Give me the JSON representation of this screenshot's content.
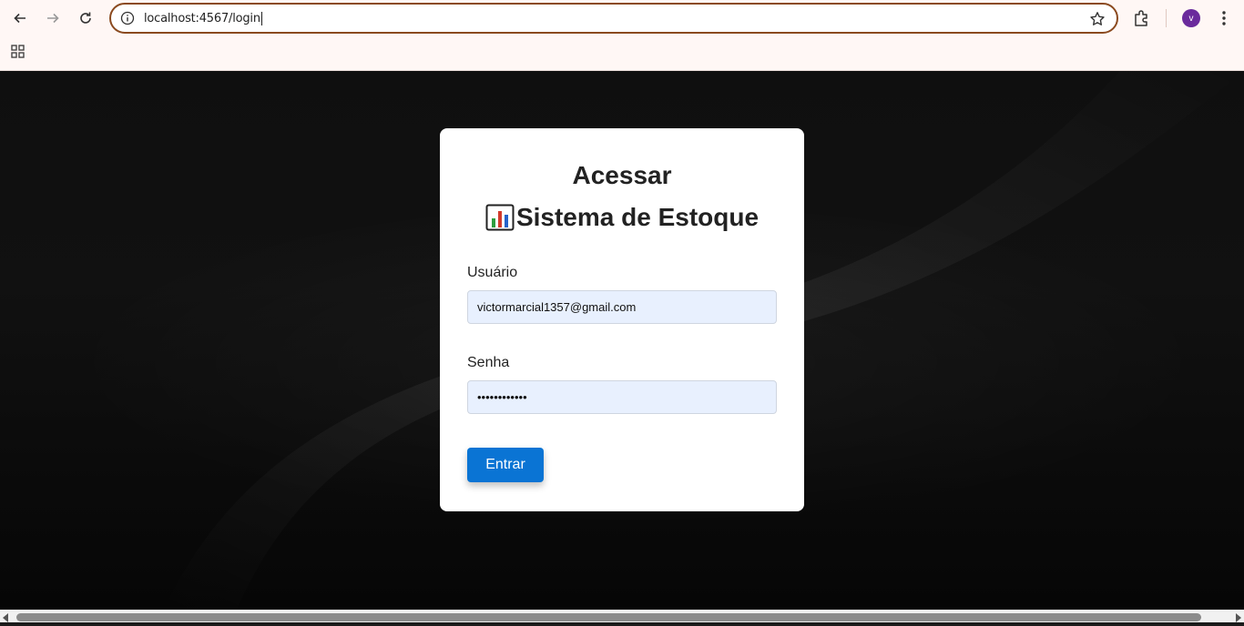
{
  "browser": {
    "url": "localhost:4567/login",
    "avatar_letter": "v",
    "accent_color": "#8b4a1f"
  },
  "login": {
    "title": "Acessar",
    "subtitle": "Sistema de Estoque",
    "subtitle_icon": "bar-chart-icon",
    "username_label": "Usuário",
    "username_value": "victormarcial1357@gmail.com",
    "password_label": "Senha",
    "password_value": "••••••••••••",
    "submit_label": "Entrar",
    "button_color": "#0a74d4",
    "input_bg_color": "#e8f0fe"
  }
}
